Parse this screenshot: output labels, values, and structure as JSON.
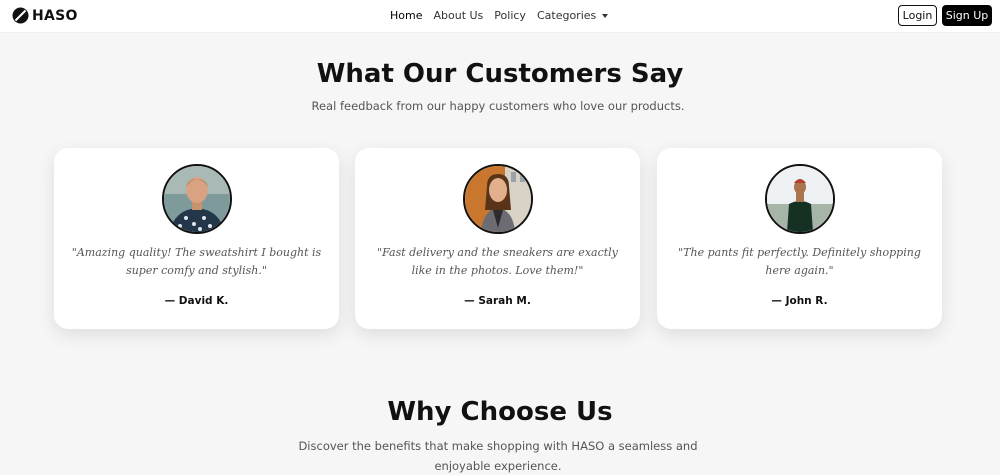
{
  "nav": {
    "brand": "HASO",
    "links": [
      "Home",
      "About Us",
      "Policy"
    ],
    "categories_label": "Categories",
    "login_label": "Login",
    "signup_label": "Sign Up"
  },
  "testimonials": {
    "title": "What Our Customers Say",
    "subtitle": "Real feedback from our happy customers who love our products.",
    "items": [
      {
        "quote": "\"Amazing quality! The sweatshirt I bought is super comfy and stylish.\"",
        "author": "— David K."
      },
      {
        "quote": "\"Fast delivery and the sneakers are exactly like in the photos. Love them!\"",
        "author": "— Sarah M."
      },
      {
        "quote": "\"The pants fit perfectly. Definitely shopping here again.\"",
        "author": "— John R."
      }
    ]
  },
  "why_choose": {
    "title": "Why Choose Us",
    "subtitle": "Discover the benefits that make shopping with HASO a seamless and enjoyable experience."
  },
  "colors": {
    "primary": "#000000",
    "background": "#f6f6f6",
    "card": "#ffffff",
    "muted_text": "#555555"
  }
}
